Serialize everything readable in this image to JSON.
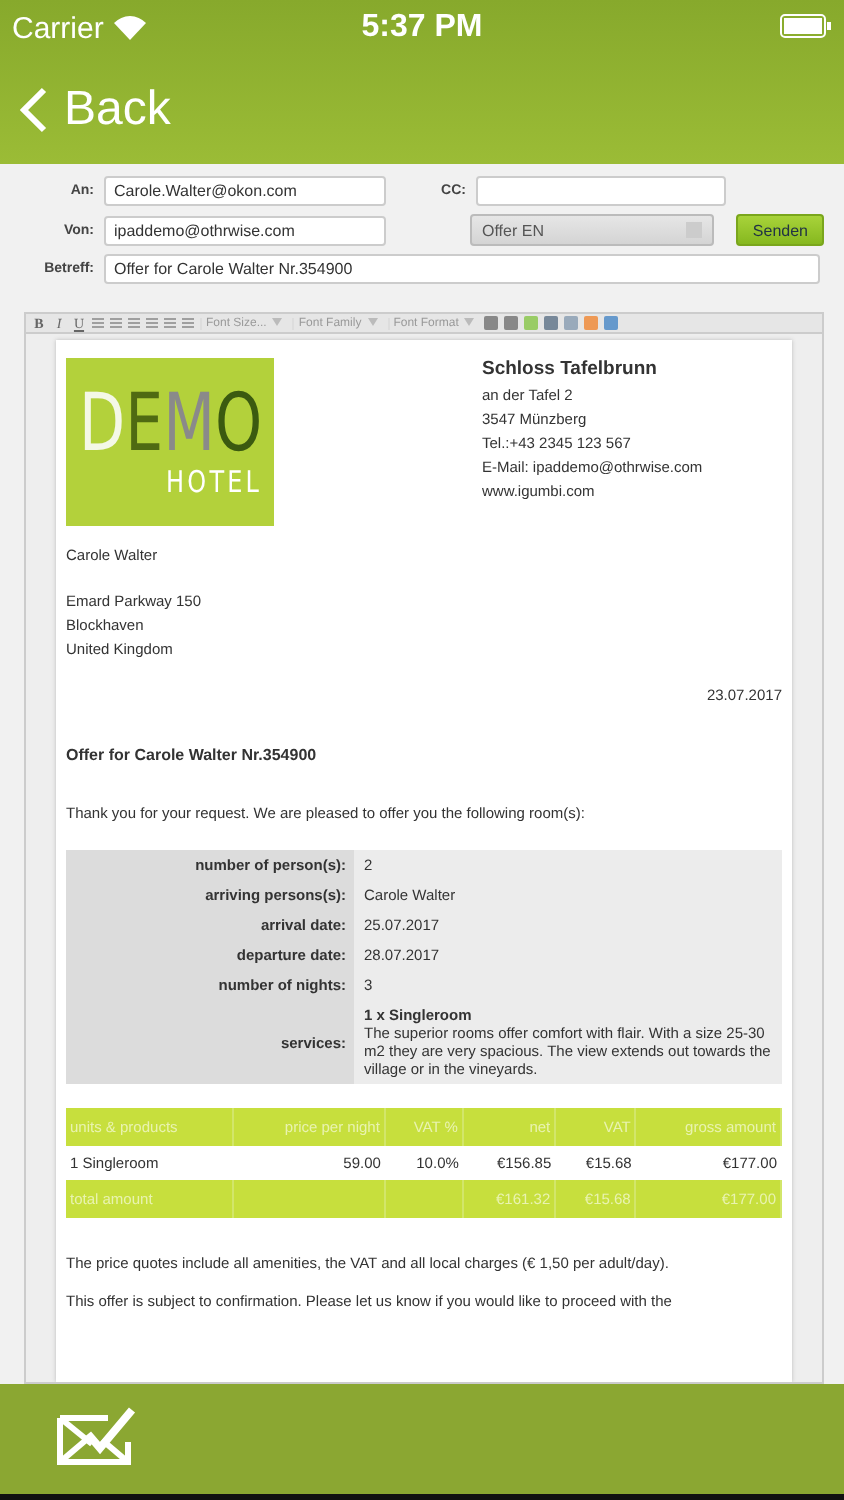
{
  "status_bar": {
    "carrier": "Carrier",
    "time": "5:37 PM"
  },
  "nav": {
    "back_label": "Back"
  },
  "form": {
    "to": {
      "label": "An:",
      "value": "Carole.Walter@okon.com"
    },
    "cc": {
      "label": "CC:"
    },
    "from": {
      "label": "Von:",
      "value": "ipaddemo@othrwise.com"
    },
    "template": {
      "value": "Offer EN"
    },
    "send_button": "Senden",
    "subject": {
      "label": "Betreff:",
      "value": "Offer for Carole Walter Nr.354900"
    }
  },
  "toolbar": {
    "format_buttons": [
      "B",
      "I",
      "U"
    ],
    "dropdowns": [
      "Font Size...",
      "Font Family",
      "Font Format"
    ]
  },
  "document": {
    "logo": {
      "word": "DEMO",
      "sub": "HOTEL"
    },
    "hotel": {
      "name": "Schloss Tafelbrunn",
      "lines": [
        "an der Tafel 2",
        "3547 Münzberg",
        "Tel.:+43 2345 123 567",
        "E-Mail: ipaddemo@othrwise.com",
        "www.igumbi.com"
      ]
    },
    "recipient": "Carole Walter",
    "address": [
      "Emard Parkway 150",
      "Blockhaven",
      "United Kingdom"
    ],
    "date": "23.07.2017",
    "heading": "Offer for Carole Walter Nr.354900",
    "intro": "Thank you for your request. We are pleased to offer you the following room(s):",
    "details": [
      {
        "label": "number of person(s):",
        "value": "2"
      },
      {
        "label": "arriving persons(s):",
        "value": "Carole Walter"
      },
      {
        "label": "arrival date:",
        "value": "25.07.2017"
      },
      {
        "label": "departure date:",
        "value": "28.07.2017"
      },
      {
        "label": "number of nights:",
        "value": "3"
      }
    ],
    "services": {
      "label": "services:",
      "title": "1 x Singleroom",
      "text": "The superior rooms offer comfort with flair. With a size 25-30 m2 they are very spacious. The view extends out towards the village or in the vineyards."
    },
    "price_table": {
      "columns": [
        "units & products",
        "price per night",
        "VAT %",
        "net",
        "VAT",
        "gross amount"
      ],
      "rows": [
        [
          "1 Singleroom",
          "59.00",
          "10.0%",
          "€156.85",
          "€15.68",
          "€177.00"
        ]
      ],
      "total": {
        "label": "total amount",
        "net": "€161.32",
        "vat": "€15.68",
        "gross": "€177.00"
      }
    },
    "note": "The price quotes include all amenities, the VAT and all local charges (€ 1,50 per adult/day).",
    "cut_line": "This offer is subject to confirmation. Please let us know if you would like to proceed with the"
  }
}
